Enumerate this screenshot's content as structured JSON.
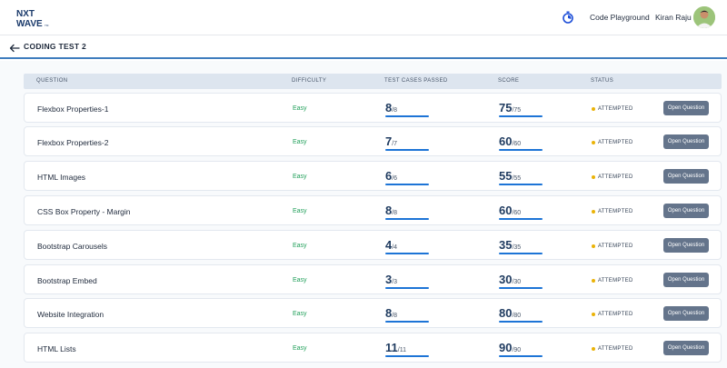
{
  "header": {
    "logo_top": "NXT",
    "logo_bottom": "WAVE",
    "logo_tm": "TM",
    "code_playground": "Code Playground",
    "user_name": "Kiran Raju"
  },
  "subheader": {
    "title": "CODING TEST 2"
  },
  "table": {
    "columns": {
      "question": "QUESTION",
      "difficulty": "DIFFICULTY",
      "test_cases": "TEST CASES PASSED",
      "score": "SCORE",
      "status": "STATUS"
    },
    "rows": [
      {
        "question": "Flexbox Properties-1",
        "difficulty": "Easy",
        "passed": "8",
        "total_cases": "/8",
        "score": "75",
        "max_score": "/75",
        "status": "ATTEMPTED",
        "action": "Open Question"
      },
      {
        "question": "Flexbox Properties-2",
        "difficulty": "Easy",
        "passed": "7",
        "total_cases": "/7",
        "score": "60",
        "max_score": "/60",
        "status": "ATTEMPTED",
        "action": "Open Question"
      },
      {
        "question": "HTML Images",
        "difficulty": "Easy",
        "passed": "6",
        "total_cases": "/6",
        "score": "55",
        "max_score": "/55",
        "status": "ATTEMPTED",
        "action": "Open Question"
      },
      {
        "question": "CSS Box Property - Margin",
        "difficulty": "Easy",
        "passed": "8",
        "total_cases": "/8",
        "score": "60",
        "max_score": "/60",
        "status": "ATTEMPTED",
        "action": "Open Question"
      },
      {
        "question": "Bootstrap Carousels",
        "difficulty": "Easy",
        "passed": "4",
        "total_cases": "/4",
        "score": "35",
        "max_score": "/35",
        "status": "ATTEMPTED",
        "action": "Open Question"
      },
      {
        "question": "Bootstrap Embed",
        "difficulty": "Easy",
        "passed": "3",
        "total_cases": "/3",
        "score": "30",
        "max_score": "/30",
        "status": "ATTEMPTED",
        "action": "Open Question"
      },
      {
        "question": "Website Integration",
        "difficulty": "Easy",
        "passed": "8",
        "total_cases": "/8",
        "score": "80",
        "max_score": "/80",
        "status": "ATTEMPTED",
        "action": "Open Question"
      },
      {
        "question": "HTML Lists",
        "difficulty": "Easy",
        "passed": "11",
        "total_cases": "/11",
        "score": "90",
        "max_score": "/90",
        "status": "ATTEMPTED",
        "action": "Open Question"
      }
    ]
  },
  "colors": {
    "accent": "#1d74d6",
    "easy": "#22a05b",
    "attempted_dot": "#eab308",
    "button": "#64748b"
  },
  "icons": {
    "back": "arrow-left-icon",
    "timer": "stopwatch-icon"
  }
}
